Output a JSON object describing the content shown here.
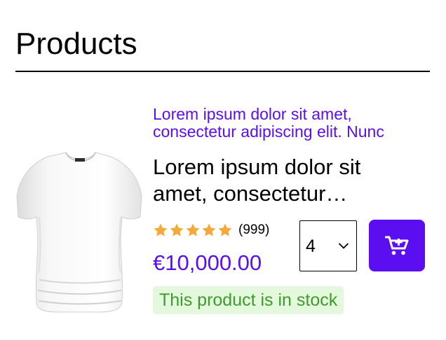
{
  "page": {
    "title": "Products"
  },
  "product": {
    "category": "Lorem ipsum dolor sit amet, consectetur adipiscing elit. Nunc",
    "name": "Lorem ipsum dolor sit amet, consectetur adipiscing",
    "rating": 5,
    "rating_max": 5,
    "review_count": "(999)",
    "price": "€10,000.00",
    "stock_status": "This product is in stock",
    "quantity": "4",
    "image_icon": "white-tshirt",
    "add_to_cart_icon": "cart-plus-icon"
  },
  "colors": {
    "accent": "#5b0ff0",
    "star": "#f4a93a",
    "stock_bg": "#e3f8dd",
    "stock_text": "#3f9b2c"
  }
}
